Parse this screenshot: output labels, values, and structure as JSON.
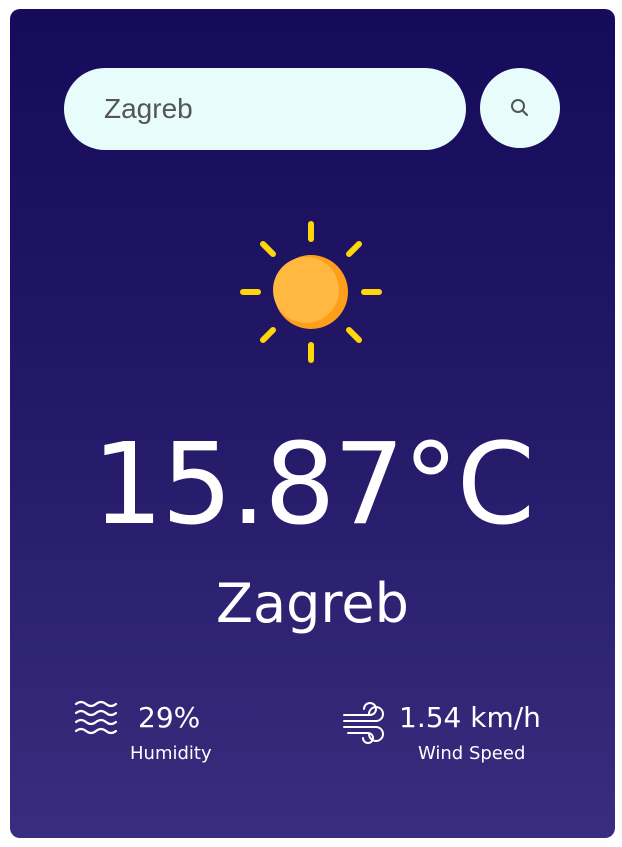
{
  "search": {
    "value": "Zagreb",
    "button_icon": "search-icon"
  },
  "weather": {
    "icon": "sun-icon",
    "temperature": "15.87°C",
    "city": "Zagreb"
  },
  "humidity": {
    "icon": "humidity-waves-icon",
    "value": "29%",
    "label": "Humidity"
  },
  "wind": {
    "icon": "wind-icon",
    "value": "1.54 km/h",
    "label": "Wind Speed"
  },
  "colors": {
    "background_top": "#160a5a",
    "background_bottom": "#3a2c7e",
    "input_background": "#e8fdfb",
    "sun_body": "#ffb13b",
    "sun_rays": "#ffd60a",
    "text": "#ffffff"
  }
}
